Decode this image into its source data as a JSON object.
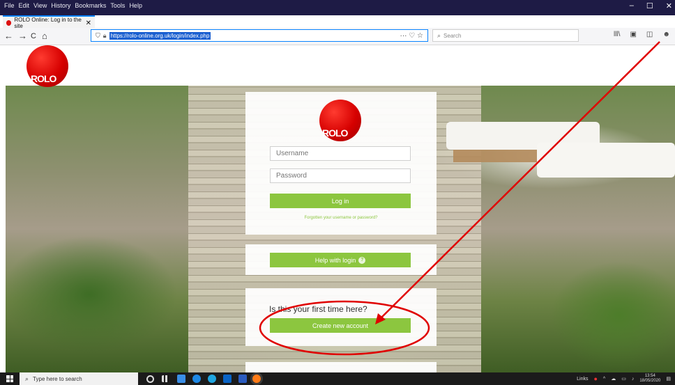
{
  "browser": {
    "menu": [
      "File",
      "Edit",
      "View",
      "History",
      "Bookmarks",
      "Tools",
      "Help"
    ],
    "window_controls": {
      "minimize": "–",
      "maximize": "☐",
      "close": "✕"
    },
    "tab": {
      "title": "ROLO Online: Log in to the site",
      "close": "✕"
    },
    "new_tab": "+",
    "nav": {
      "back": "←",
      "forward": "→",
      "reload": "C",
      "home": "⌂"
    },
    "url": "https://rolo-online.org.uk/login/index.php",
    "url_actions": "··· ♡ ☆",
    "search_placeholder": "Search",
    "tools": [
      "lll\\",
      "▣",
      "◫",
      "☻",
      "≡"
    ]
  },
  "page": {
    "logo_text": "ROLO",
    "username_placeholder": "Username",
    "password_placeholder": "Password",
    "login_label": "Log in",
    "forgot_label": "Forgotten your username or password?",
    "help_label": "Help with login",
    "help_icon": "?",
    "first_time_heading": "Is this your first time here?",
    "create_label": "Create new account"
  },
  "annotation_colors": {
    "arrow": "#e00000",
    "circle": "#e00000"
  },
  "taskbar": {
    "search_placeholder": "Type here to search",
    "tray_label": "Links",
    "time": "13:54",
    "date": "18/05/2020"
  }
}
